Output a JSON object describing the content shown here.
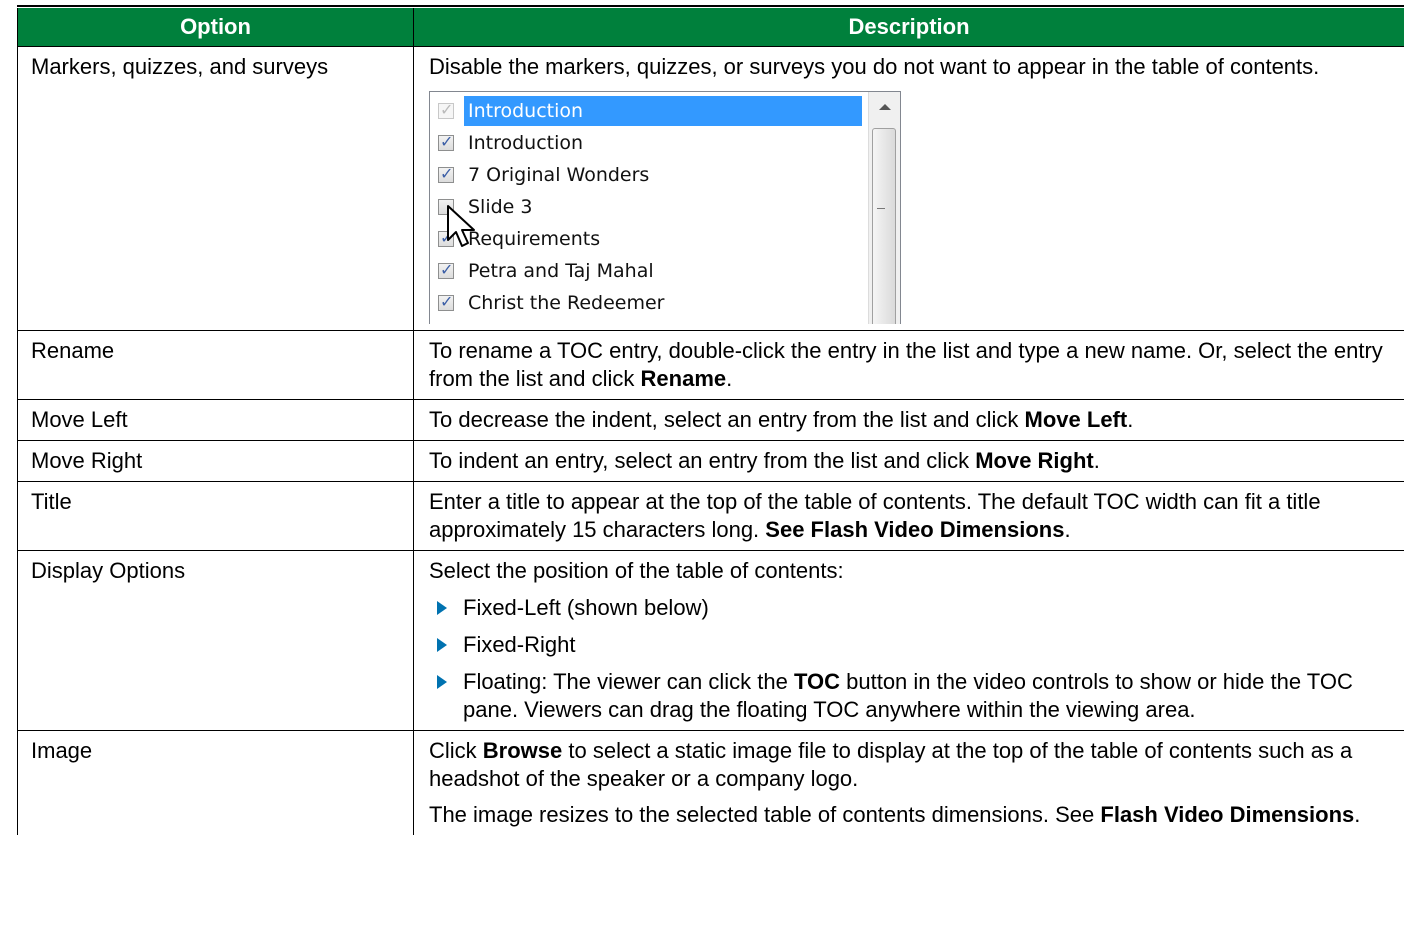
{
  "table": {
    "header": {
      "option": "Option",
      "description": "Description"
    },
    "rows": [
      {
        "option": "Markers, quizzes, and surveys",
        "desc": "Disable the markers, quizzes, or surveys you do not want to appear in the table of contents."
      },
      {
        "option": "Rename",
        "desc_pre": "To rename a TOC entry, double-click the entry in the list and type a new name. Or, select the entry from the list and click ",
        "desc_bold": "Rename",
        "desc_post": "."
      },
      {
        "option": "Move Left",
        "desc_pre": "To decrease the indent, select an entry from the list and click ",
        "desc_bold": "Move Left",
        "desc_post": "."
      },
      {
        "option": "Move Right",
        "desc_pre": "To indent an entry, select an entry from the list and click ",
        "desc_bold": "Move Right",
        "desc_post": "."
      },
      {
        "option": "Title",
        "desc_pre": "Enter a title to appear at the top of the table of contents. The default TOC width can fit a title approximately 15 characters long. ",
        "desc_bold": "See Flash Video Dimensions",
        "desc_post": "."
      },
      {
        "option": "Display Options",
        "desc": "Select the position of the table of contents:",
        "bullets": [
          {
            "text": "Fixed-Left (shown below)"
          },
          {
            "text": "Fixed-Right"
          },
          {
            "pre": "Floating: The viewer can click the ",
            "bold": "TOC",
            "post": " button in the video controls to show or hide the TOC pane. Viewers can drag the floating TOC anywhere within the viewing area."
          }
        ]
      },
      {
        "option": "Image",
        "p1_pre": "Click ",
        "p1_bold": "Browse",
        "p1_post": " to select a static image file to display at the top of the table of contents such as a headshot of the speaker or a company logo.",
        "p2_pre": "The image resizes to the selected table of contents dimensions. See ",
        "p2_bold": "Flash Video Dimensions",
        "p2_post": "."
      }
    ]
  },
  "toc_list": {
    "items": [
      {
        "label": "Introduction",
        "checked": true,
        "selected": true,
        "dimmed": true
      },
      {
        "label": "Introduction",
        "checked": true
      },
      {
        "label": "7 Original Wonders",
        "checked": true
      },
      {
        "label": "Slide 3",
        "checked": false
      },
      {
        "label": "Requirements",
        "checked": true
      },
      {
        "label": "Petra and Taj Mahal",
        "checked": true
      },
      {
        "label": "Christ the Redeemer",
        "checked": true
      }
    ]
  },
  "colors": {
    "header_bg": "#00803c",
    "bullet": "#0072b0",
    "selection": "#3399ff"
  },
  "icons": {
    "bullet": "triangle-bullet-icon",
    "checkbox": "checkbox-icon",
    "cursor": "mouse-pointer-icon",
    "scroll_up": "scroll-up-arrow-icon"
  }
}
